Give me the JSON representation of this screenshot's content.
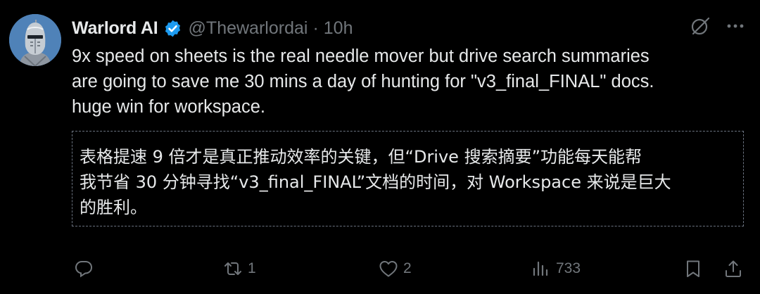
{
  "tweet": {
    "author": {
      "display_name": "Warlord AI",
      "handle": "@Thewarlordai",
      "separator": "·",
      "time": "10h",
      "verified": true
    },
    "text_lines": [
      "9x speed on sheets is the real needle mover but drive search summaries",
      "are going to save me 30 mins a day of hunting for \"v3_final_FINAL\" docs.",
      "huge win for workspace."
    ],
    "translation_lines": [
      "表格提速 9 倍才是真正推动效率的关键，但“Drive 搜索摘要”功能每天能帮",
      "我节省 30 分钟寻找“v3_final_FINAL”文档的时间，对 Workspace 来说是巨大",
      "的胜利。"
    ]
  },
  "actions": {
    "reply": {
      "icon": "reply-icon",
      "count": ""
    },
    "retweet": {
      "icon": "retweet-icon",
      "count": "1"
    },
    "like": {
      "icon": "heart-icon",
      "count": "2"
    },
    "views": {
      "icon": "views-icon",
      "count": "733"
    },
    "bookmark": {
      "icon": "bookmark-icon"
    },
    "share": {
      "icon": "share-icon"
    }
  },
  "colors": {
    "background": "#000000",
    "text_primary": "#e7e9ea",
    "text_secondary": "#71767b",
    "verified_badge": "#1d9bf0",
    "box_border": "#6b7380"
  }
}
